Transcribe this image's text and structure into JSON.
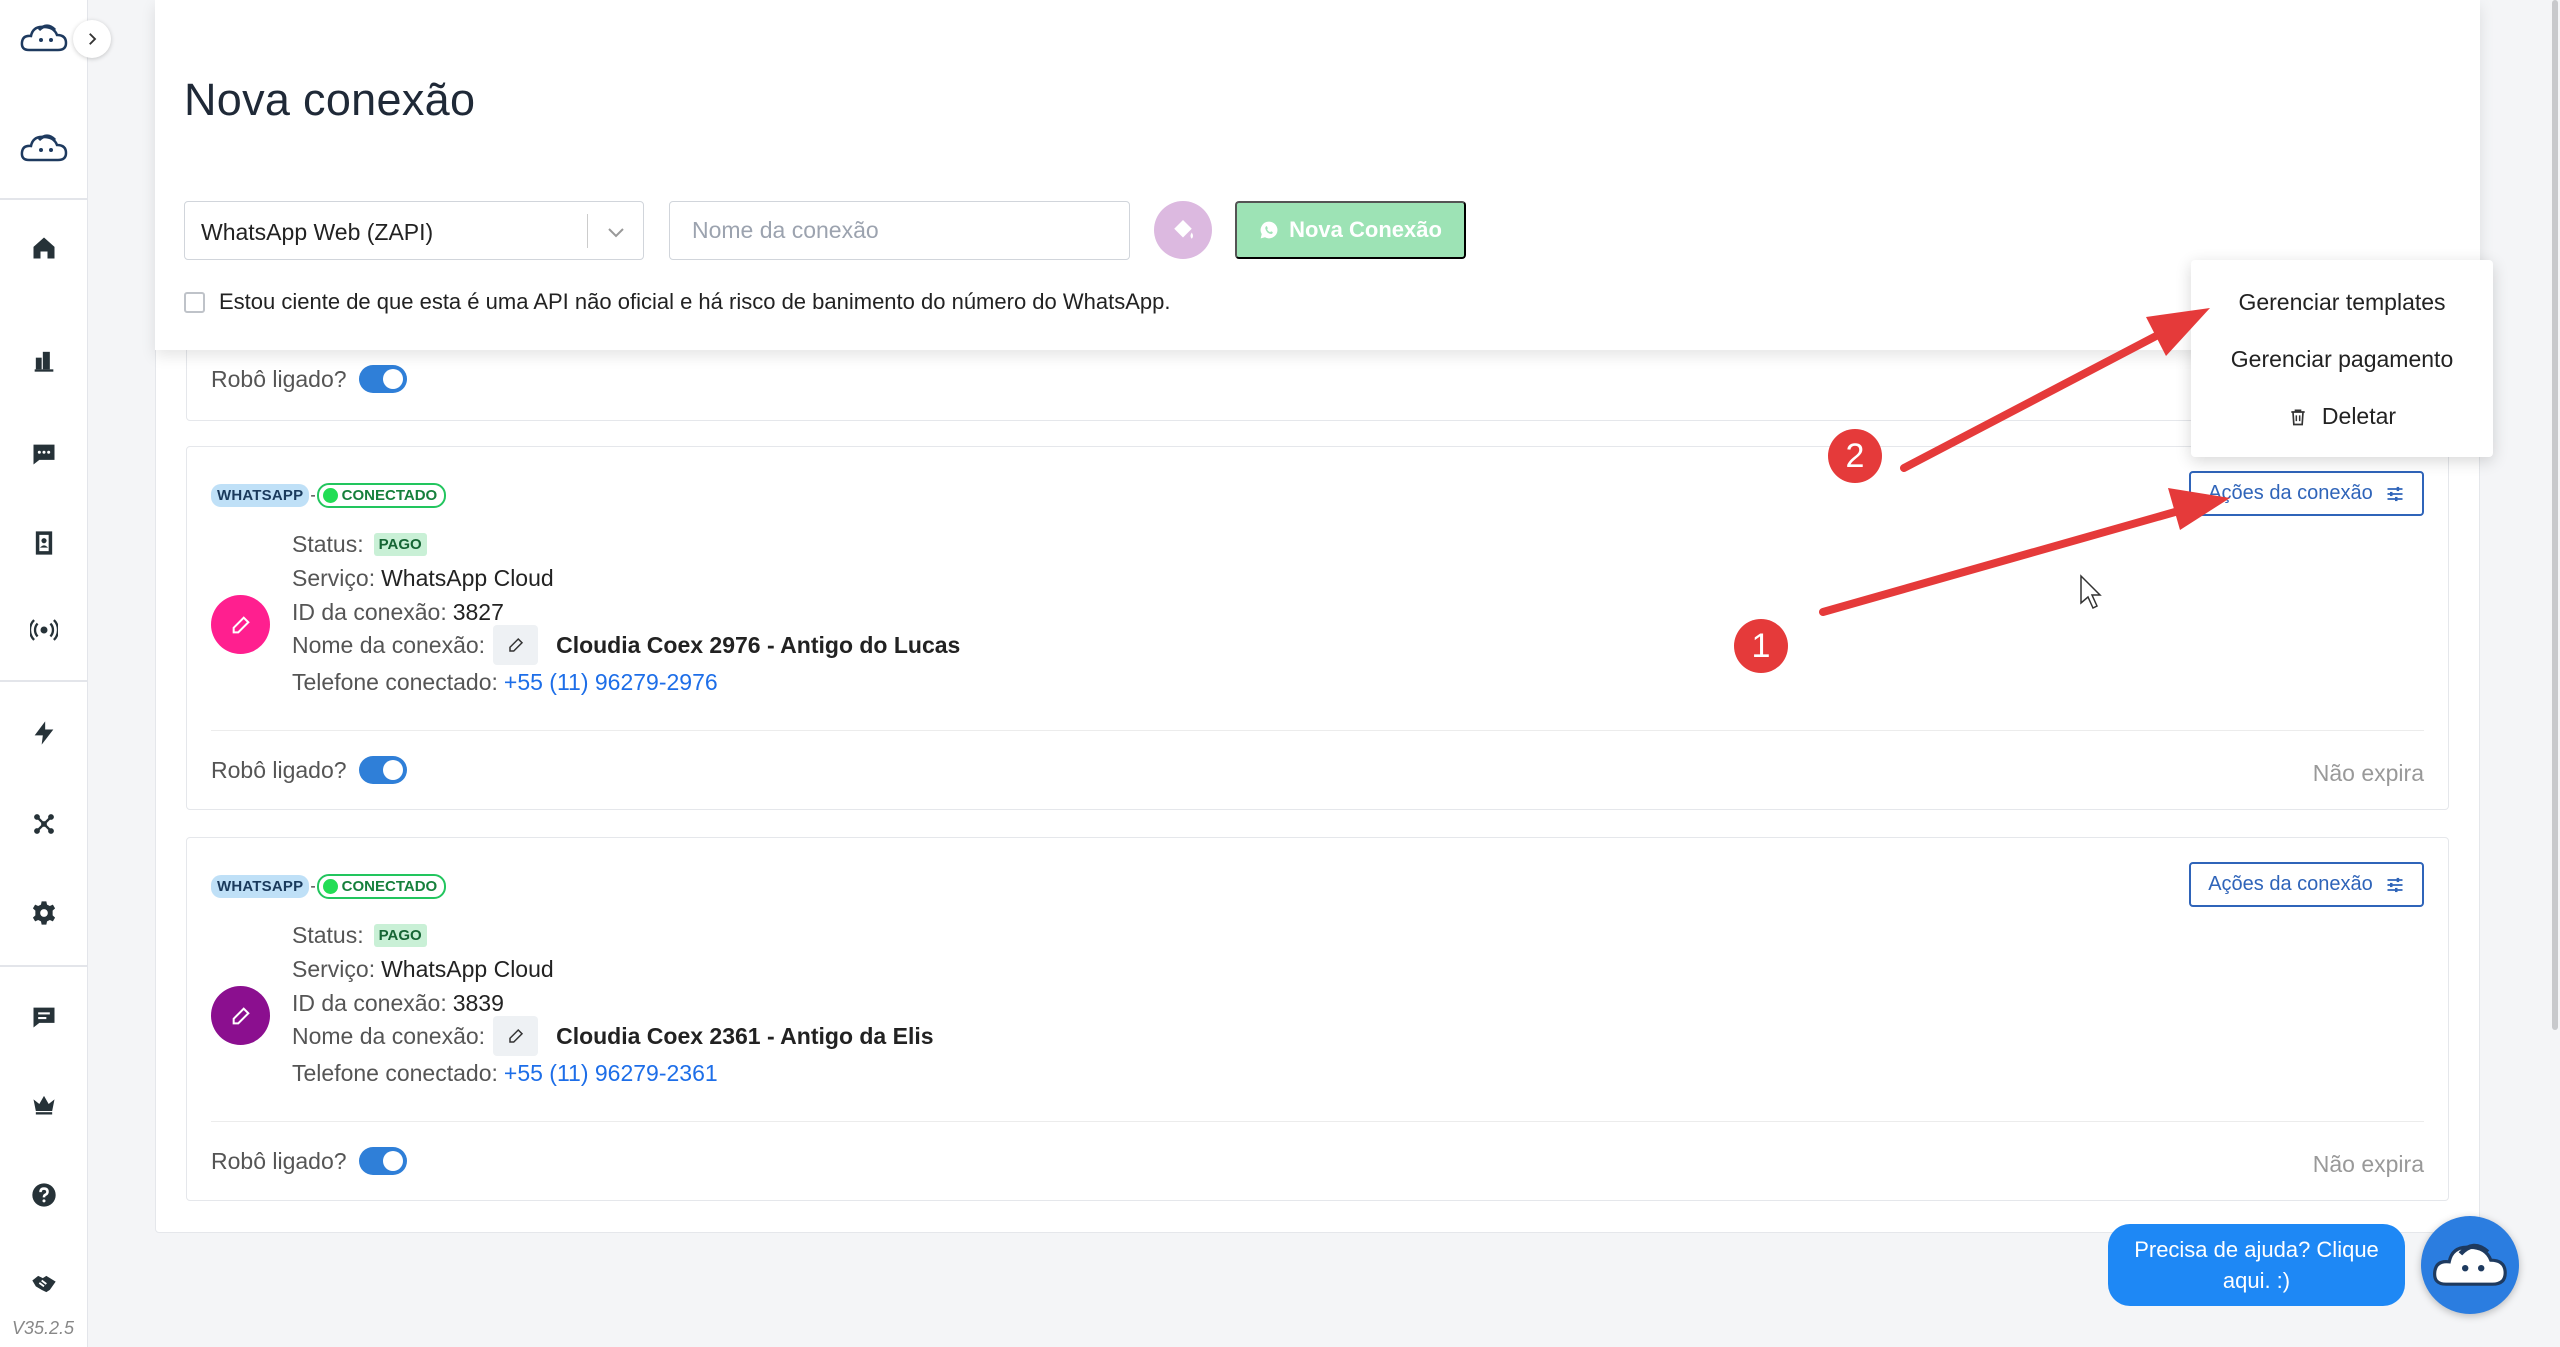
{
  "app": {
    "version": "V35.2.5"
  },
  "sidebar": {
    "items": [
      {
        "name": "home"
      },
      {
        "name": "dashboard"
      },
      {
        "name": "chat"
      },
      {
        "name": "contacts"
      },
      {
        "name": "broadcast"
      },
      {
        "name": "automation"
      },
      {
        "name": "integrations"
      },
      {
        "name": "settings"
      },
      {
        "name": "messages"
      },
      {
        "name": "plans"
      },
      {
        "name": "help"
      },
      {
        "name": "partners"
      }
    ]
  },
  "header": {
    "title": "Nova conexão",
    "channel_select": {
      "value": "WhatsApp Web (ZAPI)"
    },
    "name_input": {
      "placeholder": "Nome da conexão",
      "value": ""
    },
    "new_button_label": "Nova Conexão",
    "terms_label": "Estou ciente de que esta é uma API não oficial e há risco de banimento do número do WhatsApp."
  },
  "top_card": {
    "robot_label": "Robô ligado?",
    "robot_on": true
  },
  "connections": [
    {
      "channel": "WHATSAPP",
      "dash": "-",
      "state": "CONECTADO",
      "status_label": "Status:",
      "status_value": "PAGO",
      "service_label": "Serviço:",
      "service_value": "WhatsApp Cloud",
      "id_label": "ID da conexão:",
      "id_value": "3827",
      "name_label": "Nome da conexão:",
      "name_value": "Cloudia Coex 2976 - Antigo do Lucas",
      "phone_label": "Telefone conectado:",
      "phone_value": "+55 (11) 96279-2976",
      "robot_label": "Robô ligado?",
      "robot_on": true,
      "expiry": "Não expira",
      "actions_label": "Ações da conexão",
      "avatar_color": "#ff1f8f"
    },
    {
      "channel": "WHATSAPP",
      "dash": "-",
      "state": "CONECTADO",
      "status_label": "Status:",
      "status_value": "PAGO",
      "service_label": "Serviço:",
      "service_value": "WhatsApp Cloud",
      "id_label": "ID da conexão:",
      "id_value": "3839",
      "name_label": "Nome da conexão:",
      "name_value": "Cloudia Coex 2361 - Antigo da Elis",
      "phone_label": "Telefone conectado:",
      "phone_value": "+55 (11) 96279-2361",
      "robot_label": "Robô ligado?",
      "robot_on": true,
      "expiry": "Não expira",
      "actions_label": "Ações da conexão",
      "avatar_color": "#8b0f8f"
    }
  ],
  "dropdown": {
    "items": [
      "Gerenciar templates",
      "Gerenciar pagamento",
      "Deletar"
    ]
  },
  "annotations": {
    "markers": [
      "1",
      "2"
    ],
    "color": "#e53a3a"
  },
  "help": {
    "text": "Precisa de ajuda? Clique aqui. :)"
  },
  "colors": {
    "primary": "#2f64b9",
    "connected": "#22c55e",
    "whatsapp_button": "#9de3b5",
    "help_bubble": "#1e88f5"
  }
}
